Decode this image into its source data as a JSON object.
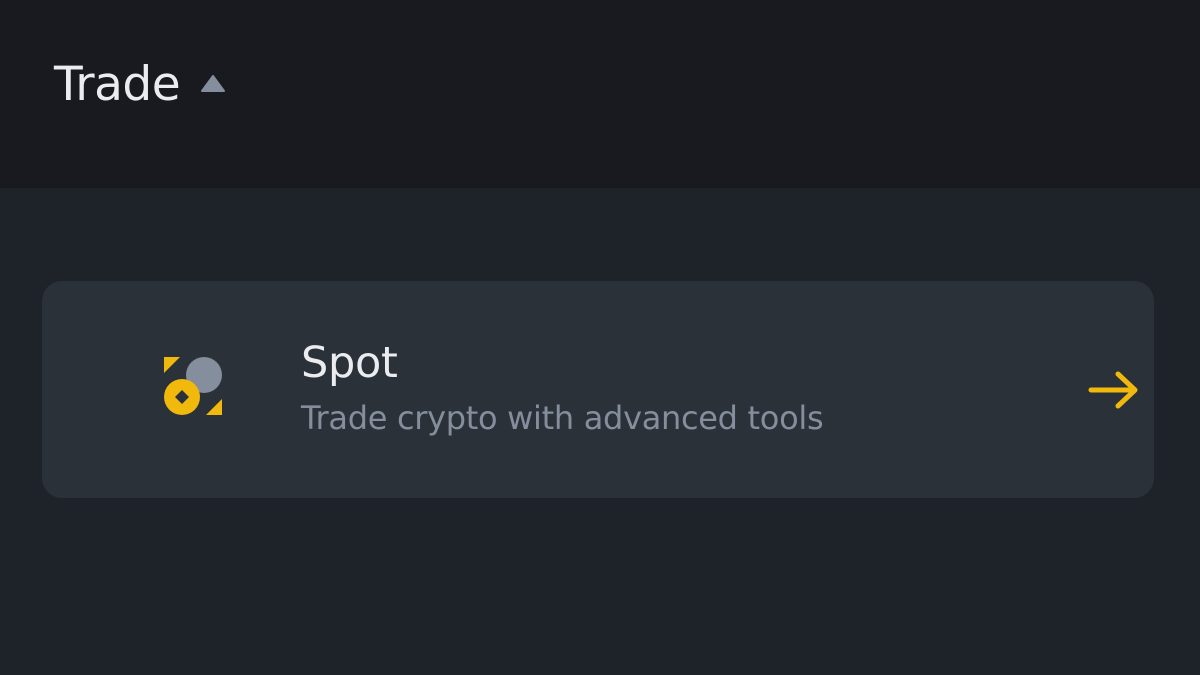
{
  "header": {
    "title": "Trade",
    "caret_icon": "caret-up-icon"
  },
  "spot_card": {
    "title": "Spot",
    "subtitle": "Trade crypto with advanced tools",
    "icon": "spot-trading-icon",
    "arrow_icon": "arrow-right-icon"
  },
  "colors": {
    "header_background": "#181a20",
    "page_background": "#1e2329",
    "card_background": "#2b3139",
    "primary_text": "#eaecef",
    "secondary_text": "#848e9c",
    "accent": "#f0b90b",
    "icon_gray": "#848e9c"
  }
}
